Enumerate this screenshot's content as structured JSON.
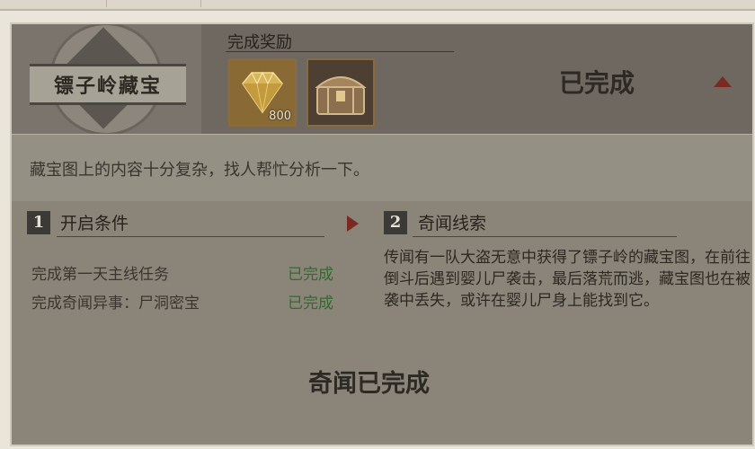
{
  "quest": {
    "title": "镖子岭藏宝",
    "status": "已完成",
    "description": "藏宝图上的内容十分复杂，找人帮忙分析一下。",
    "footer_status": "奇闻已完成"
  },
  "rewards": {
    "label": "完成奖励",
    "items": [
      {
        "icon": "gem-icon",
        "quantity": "800"
      },
      {
        "icon": "treasure-chest-icon",
        "quantity": ""
      }
    ]
  },
  "sections": [
    {
      "number": "1",
      "title": "开启条件"
    },
    {
      "number": "2",
      "title": "奇闻线索"
    }
  ],
  "conditions": [
    {
      "label": "完成第一天主线任务",
      "status": "已完成"
    },
    {
      "label": "完成奇闻异事：尸洞密宝",
      "status": "已完成"
    }
  ],
  "clue_text": "传闻有一队大盗无意中获得了镖子岭的藏宝图，在前往倒斗后遇到婴儿尸袭击，最后落荒而逃，藏宝图也在被袭中丢失，或许在婴儿尸身上能找到它。",
  "colors": {
    "accent_red": "#7a2a20",
    "completed_green": "#2f6b2f"
  }
}
